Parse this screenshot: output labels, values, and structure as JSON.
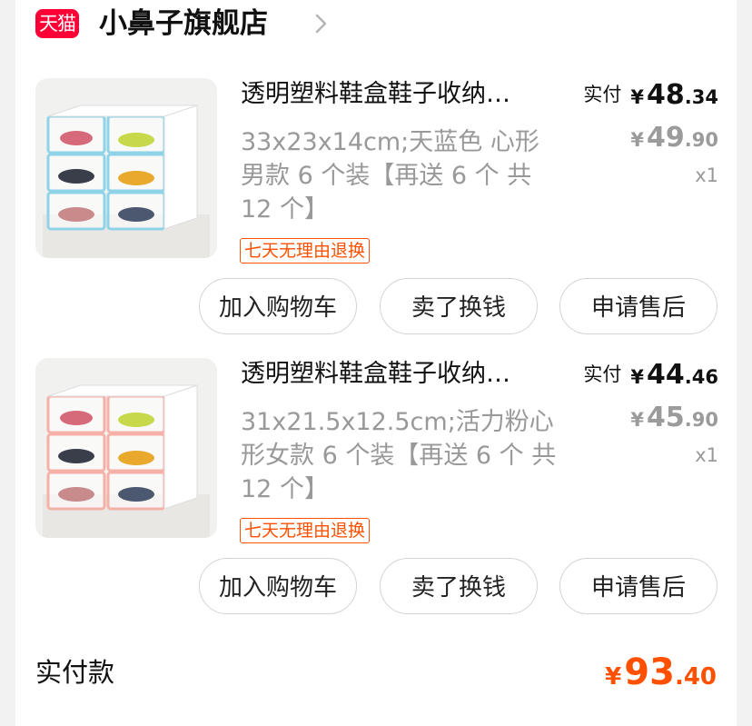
{
  "store": {
    "badge": "天猫",
    "name": "小鼻子旗舰店"
  },
  "products": [
    {
      "title": "透明塑料鞋盒鞋子收纳…",
      "sku": "33x23x14cm;天蓝色 心形男款 6 个装【再送 6 个 共 12 个】",
      "return_tag": "七天无理由退换",
      "paid_label": "实付",
      "paid_yen": "¥",
      "paid_int": "48",
      "paid_dec": ".34",
      "orig_yen": "¥",
      "orig_int": "49",
      "orig_dec": ".90",
      "qty": "x1",
      "frame_color": "#8fd3e8",
      "buttons": {
        "cart": "加入购物车",
        "sell": "卖了换钱",
        "after": "申请售后"
      }
    },
    {
      "title": "透明塑料鞋盒鞋子收纳…",
      "sku": "31x21.5x12.5cm;活力粉心形女款 6 个装【再送 6 个 共 12 个】",
      "return_tag": "七天无理由退换",
      "paid_label": "实付",
      "paid_yen": "¥",
      "paid_int": "44",
      "paid_dec": ".46",
      "orig_yen": "¥",
      "orig_int": "45",
      "orig_dec": ".90",
      "qty": "x1",
      "frame_color": "#f5b0a8",
      "buttons": {
        "cart": "加入购物车",
        "sell": "卖了换钱",
        "after": "申请售后"
      }
    }
  ],
  "total": {
    "label": "实付款",
    "yen": "¥",
    "int": "93",
    "dec": ".40"
  },
  "colors": {
    "accent": "#ff5000",
    "tmall_red": "#ff0036",
    "muted": "#999999"
  }
}
